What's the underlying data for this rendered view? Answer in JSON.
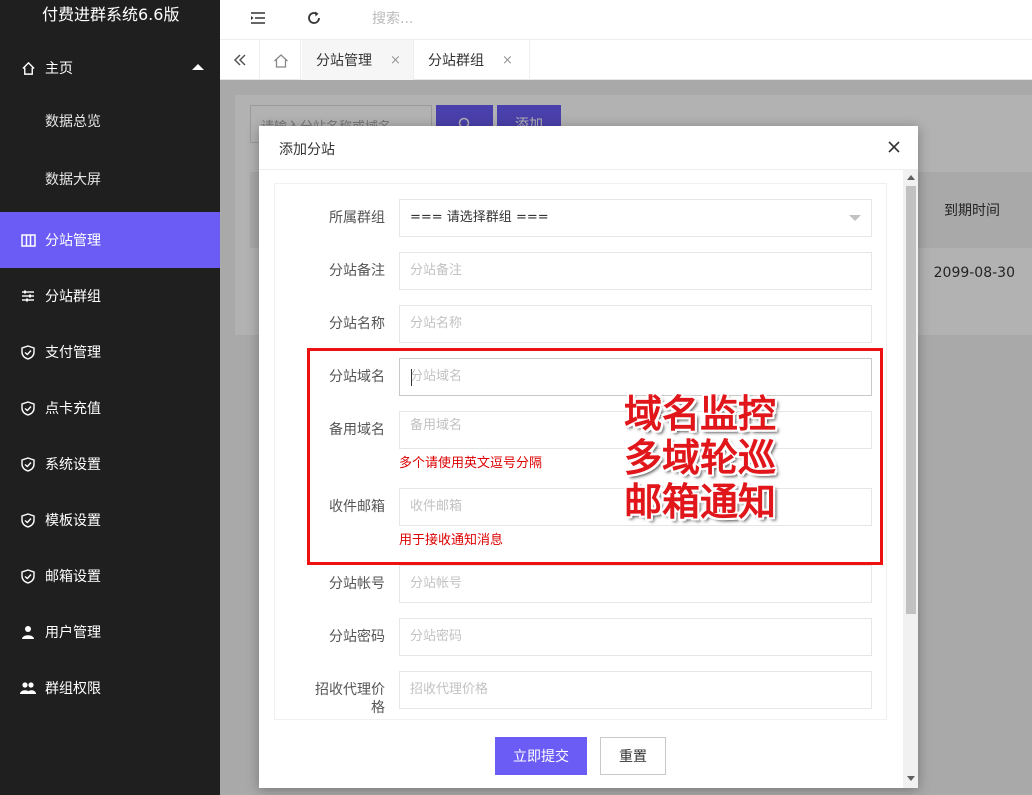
{
  "app": {
    "title": "付费进群系统6.6版"
  },
  "header": {
    "search_placeholder": "搜索..."
  },
  "sidebar": {
    "items": [
      {
        "label": "主页",
        "icon": "home-icon"
      },
      {
        "label": "数据总览"
      },
      {
        "label": "数据大屏"
      },
      {
        "label": "分站管理",
        "icon": "columns-icon",
        "active": true
      },
      {
        "label": "分站群组",
        "icon": "sliders-icon"
      },
      {
        "label": "支付管理",
        "icon": "shield-check-icon"
      },
      {
        "label": "点卡充值",
        "icon": "shield-check-icon"
      },
      {
        "label": "系统设置",
        "icon": "shield-check-icon"
      },
      {
        "label": "模板设置",
        "icon": "shield-check-icon"
      },
      {
        "label": "邮箱设置",
        "icon": "shield-check-icon"
      },
      {
        "label": "用户管理",
        "icon": "user-icon"
      },
      {
        "label": "群组权限",
        "icon": "users-icon"
      }
    ]
  },
  "tabs": [
    {
      "label": "分站管理",
      "close": "×"
    },
    {
      "label": "分站群组",
      "close": "×"
    }
  ],
  "background": {
    "search_placeholder": "请输入分站名称或域名",
    "add_button": "添加",
    "col_expire": "到期时间",
    "row_expire": "2099-08-30"
  },
  "modal": {
    "title": "添加分站",
    "fields": {
      "group": {
        "label": "所属群组",
        "value": "=== 请选择群组 ==="
      },
      "remark": {
        "label": "分站备注",
        "placeholder": "分站备注"
      },
      "name": {
        "label": "分站名称",
        "placeholder": "分站名称"
      },
      "domain": {
        "label": "分站域名",
        "placeholder": "分站域名"
      },
      "backup_domain": {
        "label": "备用域名",
        "placeholder": "备用域名",
        "hint": "多个请使用英文逗号分隔"
      },
      "email": {
        "label": "收件邮箱",
        "placeholder": "收件邮箱",
        "hint": "用于接收通知消息"
      },
      "account": {
        "label": "分站帐号",
        "placeholder": "分站帐号"
      },
      "password": {
        "label": "分站密码",
        "placeholder": "分站密码"
      },
      "agent_price": {
        "label_line1": "招收代理价",
        "label_line2": "格",
        "placeholder": "招收代理价格"
      }
    },
    "submit": "立即提交",
    "reset": "重置"
  },
  "annotation": {
    "line1": "域名监控",
    "line2": "多域轮巡",
    "line3": "邮箱通知",
    "color": "#e0161b"
  },
  "colors": {
    "accent": "#6a5cf5",
    "sidebar_bg": "#1f1f1f",
    "hint": "#dd0000"
  }
}
